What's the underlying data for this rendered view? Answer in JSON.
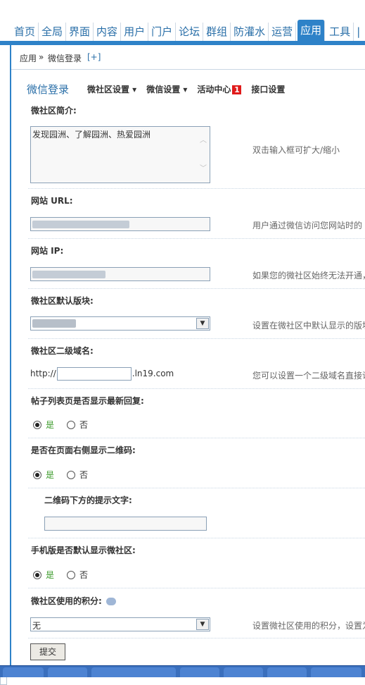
{
  "topnav": {
    "tabs": [
      "首页",
      "全局",
      "界面",
      "内容",
      "用户",
      "门户",
      "论坛",
      "群组",
      "防灌水",
      "运营",
      "应用",
      "工具",
      "|"
    ],
    "active_tab": "应用"
  },
  "breadcrumb": {
    "root": "应用",
    "separator": "»",
    "current": "微信登录",
    "add": "[+]"
  },
  "page": {
    "title": "微信登录",
    "subtabs": [
      "微社区设置 ▾",
      "微信设置 ▾",
      "活动中心",
      "接口设置"
    ],
    "badge": "1"
  },
  "form": {
    "intro": {
      "label": "微社区简介:",
      "value": "发现园洲、了解园洲、热爱园洲",
      "hint": "双击输入框可扩大/缩小"
    },
    "url": {
      "label": "网站 URL:",
      "hint": "用户通过微信访问您网站时的"
    },
    "ip": {
      "label": "网站 IP:",
      "hint": "如果您的微社区始终无法开通，"
    },
    "board": {
      "label": "微社区默认版块:",
      "hint": "设置在微社区中默认显示的版块"
    },
    "subdomain": {
      "label": "微社区二级域名:",
      "prefix": "http://",
      "suffix": ".ln19.com",
      "hint": "您可以设置一个二级域名直接访"
    },
    "show_reply": {
      "label": "帖子列表页是否显示最新回复:",
      "yes": "是",
      "no": "否"
    },
    "show_qr": {
      "label": "是否在页面右侧显示二维码:",
      "yes": "是",
      "no": "否"
    },
    "qr_text": {
      "label": "二维码下方的提示文字:"
    },
    "mobile_default": {
      "label": "手机版是否默认显示微社区:",
      "yes": "是",
      "no": "否"
    },
    "credit": {
      "label": "微社区使用的积分:",
      "value": "无",
      "hint": "设置微社区使用的积分，设置为"
    },
    "submit_label": "提交"
  }
}
